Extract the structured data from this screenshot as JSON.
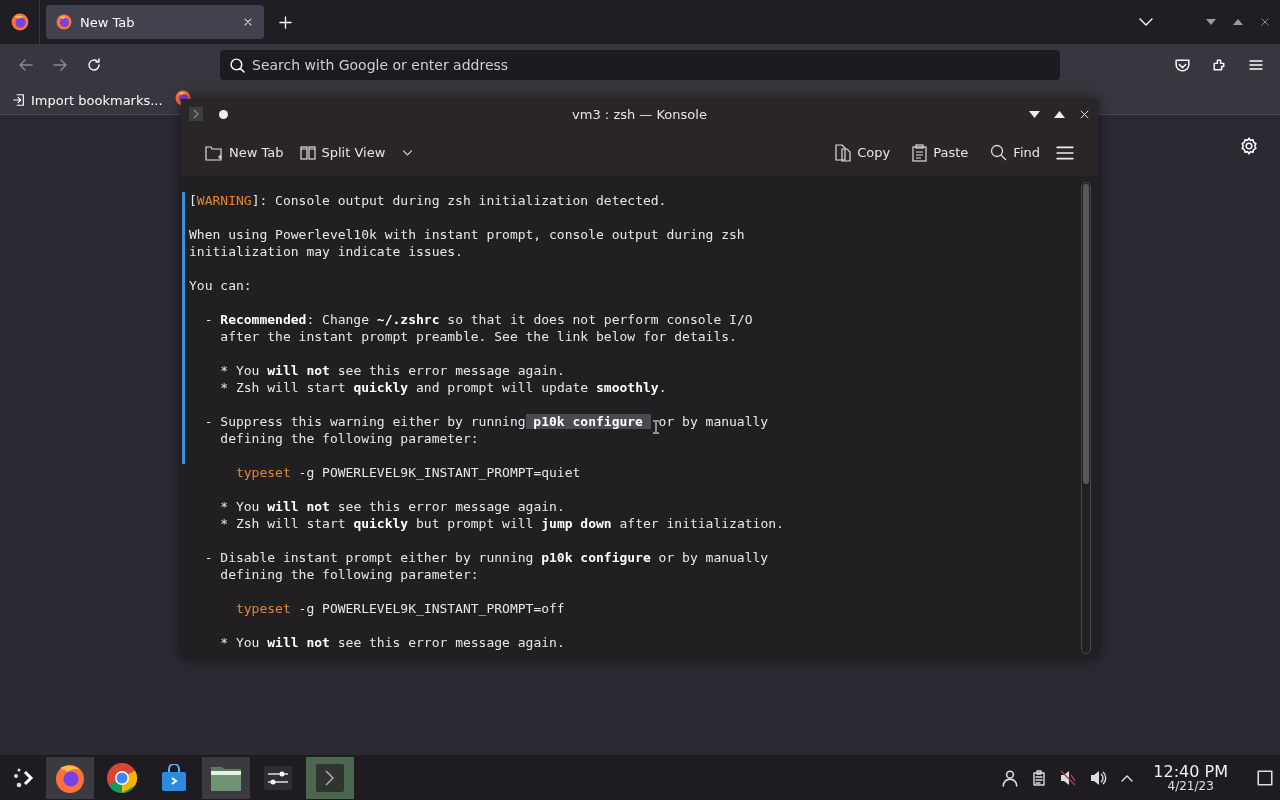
{
  "browser": {
    "tabs": [
      {
        "label": "New Tab",
        "selected": true
      }
    ],
    "address_bar": {
      "placeholder": "Search with Google or enter address"
    },
    "bookmarks": [
      {
        "label": "Import bookmarks..."
      }
    ]
  },
  "konsole": {
    "title": "vm3 : zsh — Konsole",
    "toolbar_left": [
      {
        "label": "New Tab",
        "kind": "new-tab"
      },
      {
        "label": "Split View",
        "kind": "split"
      }
    ],
    "toolbar_right": [
      {
        "label": "Copy",
        "kind": "copy"
      },
      {
        "label": "Paste",
        "kind": "paste"
      },
      {
        "label": "Find",
        "kind": "find"
      }
    ],
    "lines": [
      {
        "kind": "text",
        "marked": true,
        "parts": [
          {
            "text": "[",
            "kind": "plain"
          },
          {
            "text": "WARNING",
            "kind": "warn"
          },
          {
            "text": "]: Console output during zsh initialization detected.",
            "kind": "plain"
          }
        ]
      },
      {
        "kind": "blank",
        "marked": true
      },
      {
        "kind": "text",
        "marked": true,
        "parts": [
          {
            "text": "When using Powerlevel10k with instant prompt, console output during zsh",
            "kind": "plain"
          }
        ]
      },
      {
        "kind": "text",
        "marked": true,
        "parts": [
          {
            "text": "initialization may indicate issues.",
            "kind": "plain"
          }
        ]
      },
      {
        "kind": "blank",
        "marked": true
      },
      {
        "kind": "text",
        "marked": true,
        "parts": [
          {
            "text": "You can:",
            "kind": "plain"
          }
        ]
      },
      {
        "kind": "blank",
        "marked": true
      },
      {
        "kind": "text",
        "marked": true,
        "parts": [
          {
            "text": "  - ",
            "kind": "plain"
          },
          {
            "text": "Recommended",
            "kind": "bold"
          },
          {
            "text": ": Change ",
            "kind": "plain"
          },
          {
            "text": "~/.zshrc",
            "kind": "bold"
          },
          {
            "text": " so that it does not perform console I/O",
            "kind": "plain"
          }
        ]
      },
      {
        "kind": "text",
        "marked": true,
        "parts": [
          {
            "text": "    after the instant prompt preamble. See the link below for details.",
            "kind": "plain"
          }
        ]
      },
      {
        "kind": "blank",
        "marked": true
      },
      {
        "kind": "text",
        "marked": true,
        "parts": [
          {
            "text": "    * You ",
            "kind": "plain"
          },
          {
            "text": "will not",
            "kind": "bold"
          },
          {
            "text": " see this error message again.",
            "kind": "plain"
          }
        ]
      },
      {
        "kind": "text",
        "marked": true,
        "parts": [
          {
            "text": "    * Zsh will start ",
            "kind": "plain"
          },
          {
            "text": "quickly",
            "kind": "bold"
          },
          {
            "text": " and prompt will update ",
            "kind": "plain"
          },
          {
            "text": "smoothly",
            "kind": "bold"
          },
          {
            "text": ".",
            "kind": "plain"
          }
        ]
      },
      {
        "kind": "blank",
        "marked": true
      },
      {
        "kind": "text",
        "marked": true,
        "parts": [
          {
            "text": "  - Suppress this warning either by running",
            "kind": "plain"
          },
          {
            "text": " p10k configure ",
            "kind": "selected"
          },
          {
            "text": " or by manually",
            "kind": "plain"
          }
        ]
      },
      {
        "kind": "text",
        "marked": true,
        "parts": [
          {
            "text": "    defining the following parameter:",
            "kind": "plain"
          }
        ]
      },
      {
        "kind": "blank",
        "marked": true
      },
      {
        "kind": "text",
        "marked": false,
        "parts": [
          {
            "text": "      typeset",
            "kind": "warn"
          },
          {
            "text": " -g POWERLEVEL9K_INSTANT_PROMPT=quiet",
            "kind": "plain"
          }
        ]
      },
      {
        "kind": "blank",
        "marked": false
      },
      {
        "kind": "text",
        "marked": false,
        "parts": [
          {
            "text": "    * You ",
            "kind": "plain"
          },
          {
            "text": "will not",
            "kind": "bold"
          },
          {
            "text": " see this error message again.",
            "kind": "plain"
          }
        ]
      },
      {
        "kind": "text",
        "marked": false,
        "parts": [
          {
            "text": "    * Zsh will start ",
            "kind": "plain"
          },
          {
            "text": "quickly",
            "kind": "bold"
          },
          {
            "text": " but prompt will ",
            "kind": "plain"
          },
          {
            "text": "jump down",
            "kind": "bold"
          },
          {
            "text": " after initialization.",
            "kind": "plain"
          }
        ]
      },
      {
        "kind": "blank",
        "marked": false
      },
      {
        "kind": "text",
        "marked": false,
        "parts": [
          {
            "text": "  - Disable instant prompt either by running ",
            "kind": "plain"
          },
          {
            "text": "p10k configure",
            "kind": "bold"
          },
          {
            "text": " or by manually",
            "kind": "plain"
          }
        ]
      },
      {
        "kind": "text",
        "marked": false,
        "parts": [
          {
            "text": "    defining the following parameter:",
            "kind": "plain"
          }
        ]
      },
      {
        "kind": "blank",
        "marked": false
      },
      {
        "kind": "text",
        "marked": false,
        "parts": [
          {
            "text": "      typeset",
            "kind": "warn"
          },
          {
            "text": " -g POWERLEVEL9K_INSTANT_PROMPT=off",
            "kind": "plain"
          }
        ]
      },
      {
        "kind": "blank",
        "marked": false
      },
      {
        "kind": "text",
        "marked": false,
        "parts": [
          {
            "text": "    * You ",
            "kind": "plain"
          },
          {
            "text": "will not",
            "kind": "bold"
          },
          {
            "text": " see this error message again.",
            "kind": "plain"
          }
        ]
      }
    ]
  },
  "taskbar": {
    "apps": [
      {
        "kind": "firefox",
        "active": true
      },
      {
        "kind": "chrome",
        "active": false
      },
      {
        "kind": "store",
        "active": false
      },
      {
        "kind": "files",
        "active": true
      },
      {
        "kind": "settings",
        "active": false
      },
      {
        "kind": "terminal",
        "active": true
      }
    ],
    "clock": {
      "time": "12:40 PM",
      "date": "4/21/23"
    }
  }
}
